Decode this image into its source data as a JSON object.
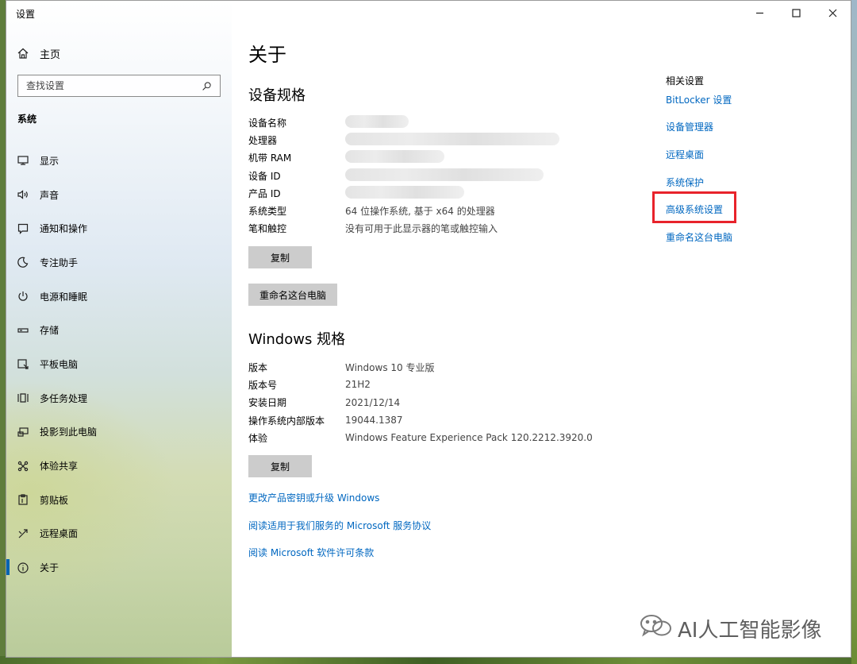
{
  "window": {
    "title": "设置"
  },
  "sidebar": {
    "home_label": "主页",
    "search_placeholder": "查找设置",
    "section_title": "系统",
    "items": [
      {
        "label": "显示",
        "icon": "monitor-icon"
      },
      {
        "label": "声音",
        "icon": "speaker-icon"
      },
      {
        "label": "通知和操作",
        "icon": "notification-icon"
      },
      {
        "label": "专注助手",
        "icon": "moon-icon"
      },
      {
        "label": "电源和睡眠",
        "icon": "power-icon"
      },
      {
        "label": "存储",
        "icon": "storage-icon"
      },
      {
        "label": "平板电脑",
        "icon": "tablet-icon"
      },
      {
        "label": "多任务处理",
        "icon": "multitask-icon"
      },
      {
        "label": "投影到此电脑",
        "icon": "project-icon"
      },
      {
        "label": "体验共享",
        "icon": "share-icon"
      },
      {
        "label": "剪贴板",
        "icon": "clipboard-icon"
      },
      {
        "label": "远程桌面",
        "icon": "remote-icon"
      },
      {
        "label": "关于",
        "icon": "info-icon",
        "active": true
      }
    ]
  },
  "main": {
    "title": "关于",
    "device_spec": {
      "heading": "设备规格",
      "rows": [
        {
          "key": "设备名称",
          "value": ""
        },
        {
          "key": "处理器",
          "value": ""
        },
        {
          "key": "机带 RAM",
          "value": ""
        },
        {
          "key": "设备 ID",
          "value": ""
        },
        {
          "key": "产品 ID",
          "value": ""
        },
        {
          "key": "系统类型",
          "value": "64 位操作系统, 基于 x64 的处理器"
        },
        {
          "key": "笔和触控",
          "value": "没有可用于此显示器的笔或触控输入"
        }
      ],
      "copy_button": "复制",
      "rename_button": "重命名这台电脑"
    },
    "windows_spec": {
      "heading": "Windows 规格",
      "rows": [
        {
          "key": "版本",
          "value": "Windows 10 专业版"
        },
        {
          "key": "版本号",
          "value": "21H2"
        },
        {
          "key": "安装日期",
          "value": "2021/12/14"
        },
        {
          "key": "操作系统内部版本",
          "value": "19044.1387"
        },
        {
          "key": "体验",
          "value": "Windows Feature Experience Pack 120.2212.3920.0"
        }
      ],
      "copy_button": "复制"
    },
    "links": [
      "更改产品密钥或升级 Windows",
      "阅读适用于我们服务的 Microsoft 服务协议",
      "阅读 Microsoft 软件许可条款"
    ]
  },
  "related": {
    "heading": "相关设置",
    "links": [
      "BitLocker 设置",
      "设备管理器",
      "远程桌面",
      "系统保护",
      "高级系统设置",
      "重命名这台电脑"
    ]
  },
  "watermark": {
    "text": "AI人工智能影像"
  },
  "colors": {
    "link": "#0067c0",
    "accent": "#0063b1",
    "highlight": "#e8232b",
    "button": "#cccccc"
  }
}
